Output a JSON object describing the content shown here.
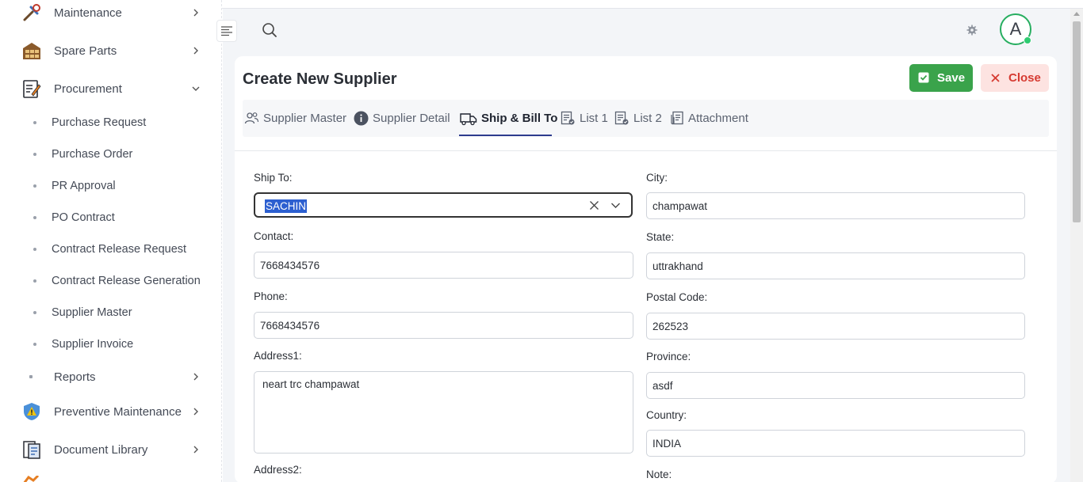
{
  "sidebar": {
    "top_items": [
      {
        "label": "Maintenance"
      },
      {
        "label": "Spare Parts"
      },
      {
        "label": "Procurement"
      }
    ],
    "procurement_sub": [
      {
        "label": "Purchase Request"
      },
      {
        "label": "Purchase Order"
      },
      {
        "label": "PR Approval"
      },
      {
        "label": "PO Contract"
      },
      {
        "label": "Contract Release Request"
      },
      {
        "label": "Contract Release Generation"
      },
      {
        "label": "Supplier Master"
      },
      {
        "label": "Supplier Invoice"
      }
    ],
    "reports": {
      "label": "Reports"
    },
    "bottom_items": [
      {
        "label": "Preventive Maintenance"
      },
      {
        "label": "Document Library"
      }
    ]
  },
  "header": {
    "avatar_letter": "A"
  },
  "page": {
    "title": "Create New Supplier",
    "save_label": "Save",
    "close_label": "Close"
  },
  "tabs": [
    {
      "label": "Supplier Master",
      "icon": "users-icon"
    },
    {
      "label": "Supplier Detail",
      "icon": "info-icon"
    },
    {
      "label": "Ship & Bill To",
      "icon": "truck-icon",
      "active": true
    },
    {
      "label": "List 1",
      "icon": "list-check-icon"
    },
    {
      "label": "List 2",
      "icon": "list-check-icon"
    },
    {
      "label": "Attachment",
      "icon": "attachment-icon"
    }
  ],
  "form": {
    "ship_to": {
      "label": "Ship To:",
      "value": "SACHIN"
    },
    "contact": {
      "label": "Contact:",
      "value": "7668434576"
    },
    "phone": {
      "label": "Phone:",
      "value": "7668434576"
    },
    "address1": {
      "label": "Address1:",
      "value": "neart trc champawat"
    },
    "address2": {
      "label": "Address2:"
    },
    "city": {
      "label": "City:",
      "value": "champawat"
    },
    "state": {
      "label": "State:",
      "value": "uttrakhand"
    },
    "postal_code": {
      "label": "Postal Code:",
      "value": "262523"
    },
    "province": {
      "label": "Province:",
      "value": "asdf"
    },
    "country": {
      "label": "Country:",
      "value": "INDIA"
    },
    "note": {
      "label": "Note:"
    }
  },
  "colors": {
    "save": "#3aa34b",
    "close_bg": "#fde3e1",
    "close_text": "#d63a31",
    "active_tab": "#2d3b8e",
    "avatar_ring": "#27ae60"
  }
}
